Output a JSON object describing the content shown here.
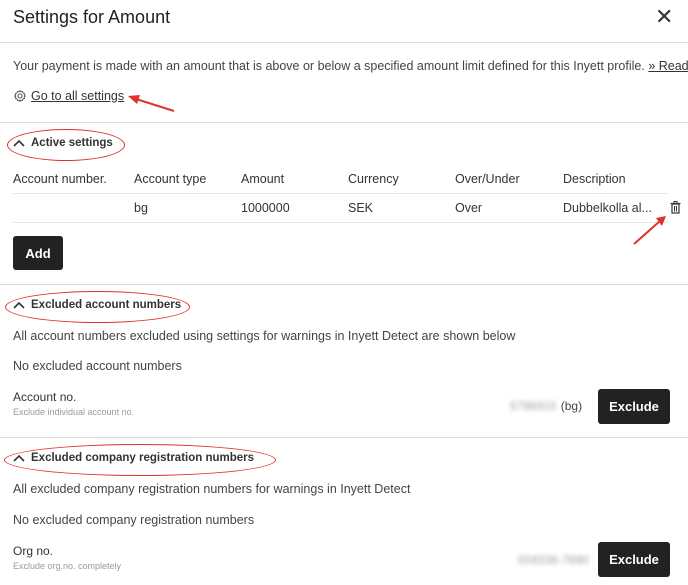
{
  "dialog": {
    "title": "Settings for Amount"
  },
  "intro": {
    "text": "Your payment is made with an amount that is above or below a specified amount limit defined for this Inyett profile.",
    "read_more": "» Read more",
    "settings_link": "Go to all settings"
  },
  "active": {
    "heading": "Active settings",
    "columns": [
      "Account number.",
      "Account type",
      "Amount",
      "Currency",
      "Over/Under",
      "Description"
    ],
    "rows": [
      {
        "account_number": "",
        "account_type": "bg",
        "amount": "1000000",
        "currency": "SEK",
        "over_under": "Over",
        "description": "Dubbelkolla al..."
      }
    ],
    "add_label": "Add"
  },
  "excluded_accounts": {
    "heading": "Excluded account numbers",
    "description": "All account numbers excluded using settings for warnings in Inyett Detect are shown below",
    "empty_text": "No excluded account numbers",
    "field_label": "Account no.",
    "field_hint": "Exclude individual account no.",
    "value_masked": "5786915",
    "value_suffix": "(bg)",
    "button_label": "Exclude"
  },
  "excluded_orgs": {
    "heading": "Excluded company registration numbers",
    "description": "All excluded company registration numbers for warnings in Inyett Detect",
    "empty_text": "No excluded company registration numbers",
    "field_label": "Org no.",
    "field_hint": "Exclude org.no. completely",
    "value_masked": "559336-7690",
    "button_label": "Exclude"
  },
  "annotation_color": "#e0322c"
}
